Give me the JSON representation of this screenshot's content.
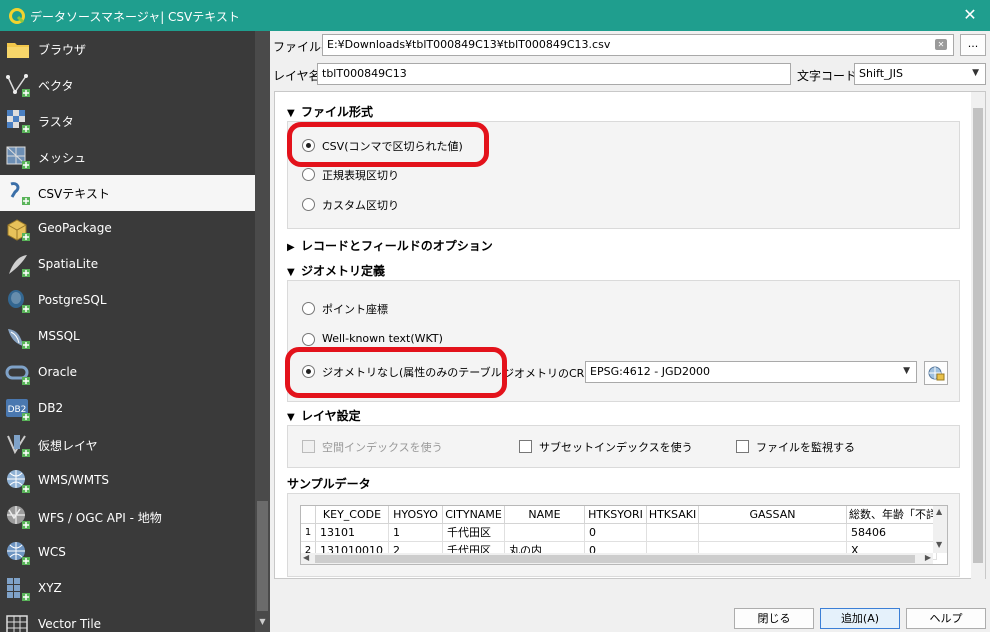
{
  "window": {
    "title": "データソースマネージャ| CSVテキスト",
    "close": "✕"
  },
  "sidebar": {
    "items": [
      {
        "label": "ブラウザ",
        "icon": "folder-icon"
      },
      {
        "label": "ベクタ",
        "icon": "vector-icon"
      },
      {
        "label": "ラスタ",
        "icon": "raster-icon"
      },
      {
        "label": "メッシュ",
        "icon": "mesh-icon"
      },
      {
        "label": "CSVテキスト",
        "icon": "csv-icon"
      },
      {
        "label": "GeoPackage",
        "icon": "geopackage-icon"
      },
      {
        "label": "SpatiaLite",
        "icon": "spatialite-icon"
      },
      {
        "label": "PostgreSQL",
        "icon": "postgresql-icon"
      },
      {
        "label": "MSSQL",
        "icon": "mssql-icon"
      },
      {
        "label": "Oracle",
        "icon": "oracle-icon"
      },
      {
        "label": "DB2",
        "icon": "db2-icon"
      },
      {
        "label": "仮想レイヤ",
        "icon": "virtual-layer-icon"
      },
      {
        "label": "WMS/WMTS",
        "icon": "wms-icon"
      },
      {
        "label": "WFS / OGC API - 地物",
        "icon": "wfs-icon"
      },
      {
        "label": "WCS",
        "icon": "wcs-icon"
      },
      {
        "label": "XYZ",
        "icon": "xyz-icon"
      },
      {
        "label": "Vector Tile",
        "icon": "vector-tile-icon"
      }
    ],
    "db2_badge": "DB2"
  },
  "file": {
    "label": "ファイル名",
    "value": "E:¥Downloads¥tblT000849C13¥tblT000849C13.csv",
    "browse": "..."
  },
  "layer": {
    "label": "レイヤ名",
    "value": "tblT000849C13",
    "encoding_label": "文字コード",
    "encoding": "Shift_JIS"
  },
  "format": {
    "title": "ファイル形式",
    "options": [
      "CSV(コンマで区切られた値)",
      "正規表現区切り",
      "カスタム区切り"
    ]
  },
  "record_options": {
    "title": "レコードとフィールドのオプション"
  },
  "geometry": {
    "title": "ジオメトリ定義",
    "options": [
      "ポイント座標",
      "Well-known text(WKT)",
      "ジオメトリなし(属性のみのテーブル)"
    ],
    "crs_label": "ジオメトリのCRS",
    "crs_value": "EPSG:4612 - JGD2000"
  },
  "layer_settings": {
    "title": "レイヤ設定",
    "checks": [
      "空間インデックスを使う",
      "サブセットインデックスを使う",
      "ファイルを監視する"
    ]
  },
  "sample": {
    "title": "サンプルデータ",
    "headers": [
      "KEY_CODE",
      "HYOSYO",
      "CITYNAME",
      "NAME",
      "HTKSYORI",
      "HTKSAKI",
      "GASSAN",
      "総数、年齢「不詳"
    ],
    "rows": [
      {
        "n": "1",
        "cells": [
          "13101",
          "1",
          "千代田区",
          "",
          "0",
          "",
          "",
          "58406"
        ]
      },
      {
        "n": "2",
        "cells": [
          "131010010",
          "2",
          "千代田区",
          "丸の内",
          "0",
          "",
          "",
          "X"
        ]
      }
    ]
  },
  "buttons": {
    "close": "閉じる",
    "add": "追加(A)",
    "help": "ヘルプ"
  }
}
